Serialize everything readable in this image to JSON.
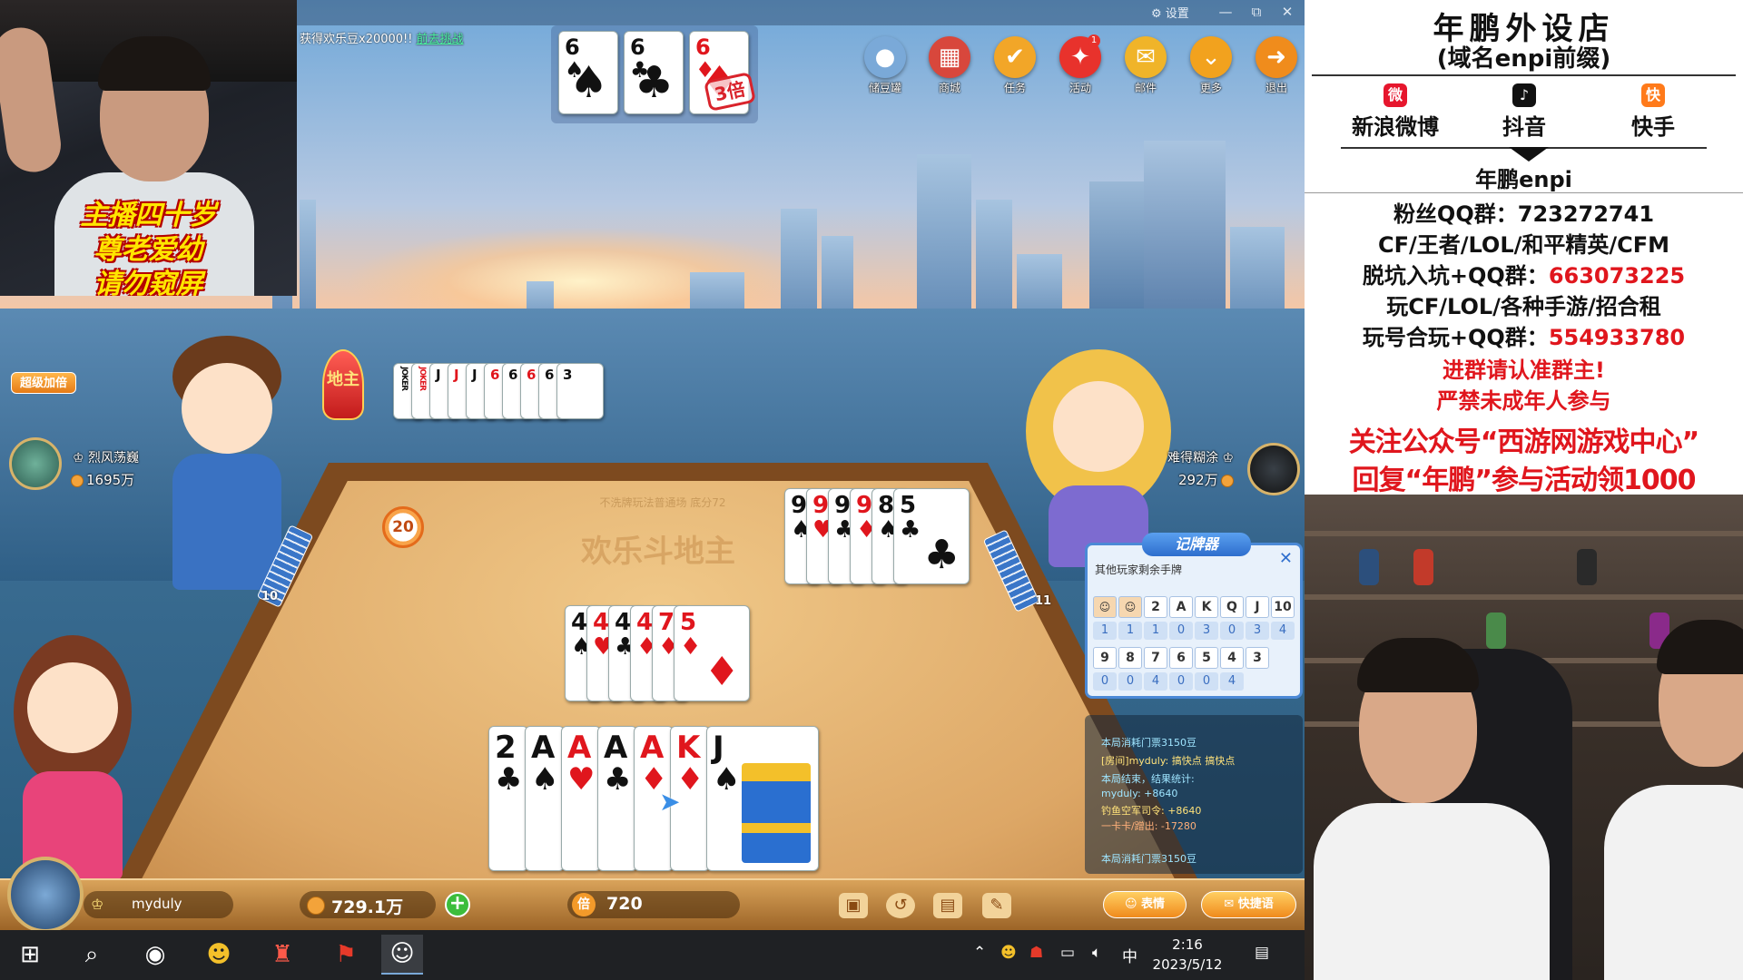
{
  "webcam_top": {
    "caption_lines": [
      "主播四十岁",
      "尊老爱幼",
      "请勿窥屏"
    ]
  },
  "game": {
    "titlebar": {
      "settings_label": "设置",
      "minimize": "—",
      "restore": "⧉",
      "close": "✕"
    },
    "reward_banner": {
      "text": "获得欢乐豆x20000!!",
      "link": "前去挑战"
    },
    "top_icons": [
      {
        "icon": "bean-bag-icon",
        "label": "储豆罐",
        "glyph": "●",
        "color": "#7aa9d8"
      },
      {
        "icon": "shop-icon",
        "label": "商城",
        "glyph": "▦",
        "color": "#d8473c"
      },
      {
        "icon": "task-icon",
        "label": "任务",
        "glyph": "✔",
        "color": "#f2a628"
      },
      {
        "icon": "gift-icon",
        "label": "活动",
        "glyph": "✦",
        "color": "#e8322c",
        "badge": "1"
      },
      {
        "icon": "mail-icon",
        "label": "邮件",
        "glyph": "✉",
        "color": "#f0b429"
      },
      {
        "icon": "more-icon",
        "label": "更多",
        "glyph": "⌄",
        "color": "#f2a21e"
      },
      {
        "icon": "exit-icon",
        "label": "退出",
        "glyph": "➜",
        "color": "#f08c1c"
      }
    ],
    "landlord_cards": [
      {
        "rank": "6",
        "suit": "♠",
        "color": "blk"
      },
      {
        "rank": "6",
        "suit": "♣",
        "color": "blk"
      },
      {
        "rank": "6",
        "suit": "♦",
        "color": "red"
      }
    ],
    "landlord_multiplier": "3倍",
    "table_info": "不洗牌玩法普通场 底分72",
    "table_logo": "欢乐斗地主",
    "super_double": "超级加倍",
    "landlord_badge": "地主",
    "timer": "20",
    "left_player": {
      "name": "烈风荡巍",
      "coins": "1695万",
      "cards_left": "10"
    },
    "right_player": {
      "name": "难得糊涂",
      "coins": "292万",
      "cards_left": "11"
    },
    "landlord_played_pile": [
      "JOKER",
      "JOKER",
      "J",
      "J",
      "J",
      "6",
      "6",
      "6",
      "6",
      "3"
    ],
    "right_played": [
      {
        "rank": "9",
        "suit": "♠",
        "color": "blk"
      },
      {
        "rank": "9",
        "suit": "♥",
        "color": "red"
      },
      {
        "rank": "9",
        "suit": "♣",
        "color": "blk"
      },
      {
        "rank": "9",
        "suit": "♦",
        "color": "red"
      },
      {
        "rank": "8",
        "suit": "♠",
        "color": "blk"
      },
      {
        "rank": "5",
        "suit": "♣",
        "color": "blk"
      }
    ],
    "center_played": [
      {
        "rank": "4",
        "suit": "♠",
        "color": "blk"
      },
      {
        "rank": "4",
        "suit": "♥",
        "color": "red"
      },
      {
        "rank": "4",
        "suit": "♣",
        "color": "blk"
      },
      {
        "rank": "4",
        "suit": "♦",
        "color": "red"
      },
      {
        "rank": "7",
        "suit": "♦",
        "color": "red"
      },
      {
        "rank": "5",
        "suit": "♦",
        "color": "red"
      }
    ],
    "my_hand": [
      {
        "rank": "2",
        "suit": "♣",
        "color": "blk"
      },
      {
        "rank": "A",
        "suit": "♠",
        "color": "blk"
      },
      {
        "rank": "A",
        "suit": "♥",
        "color": "red"
      },
      {
        "rank": "A",
        "suit": "♣",
        "color": "blk"
      },
      {
        "rank": "A",
        "suit": "♦",
        "color": "red"
      },
      {
        "rank": "K",
        "suit": "♦",
        "color": "red"
      },
      {
        "rank": "J",
        "suit": "♠",
        "color": "blk"
      }
    ],
    "tracker": {
      "title": "记牌器",
      "subtitle": "其他玩家剩余手牌",
      "row1_labels": [
        "大王",
        "小王",
        "2",
        "A",
        "K",
        "Q",
        "J",
        "10"
      ],
      "row1_counts": [
        "1",
        "1",
        "1",
        "0",
        "3",
        "0",
        "3",
        "4"
      ],
      "row2_labels": [
        "9",
        "8",
        "7",
        "6",
        "5",
        "4",
        "3"
      ],
      "row2_counts": [
        "0",
        "0",
        "4",
        "0",
        "0",
        "4"
      ]
    },
    "chat": [
      {
        "text": "本局消耗门票3150豆",
        "cls": ""
      },
      {
        "text": "[房间]myduly: 搞快点 搞快点",
        "cls": "y"
      },
      {
        "text": "本局结束，结果统计:",
        "cls": ""
      },
      {
        "text": "myduly: +8640",
        "cls": ""
      },
      {
        "text": "钓鱼空军司令: +8640",
        "cls": "y"
      },
      {
        "text": "一卡卡/蹭出: -17280",
        "cls": "o"
      },
      {
        "text": "本局消耗门票3150豆",
        "cls": ""
      }
    ],
    "me": {
      "name": "myduly",
      "coins": "729.1万",
      "multiplier_label": "倍",
      "multiplier": "720"
    },
    "bottom_buttons": {
      "emoji": "表情",
      "quick": "快捷语"
    }
  },
  "taskbar": {
    "time": "2:16",
    "date": "2023/5/12",
    "ime": "中"
  },
  "info_panel": {
    "title": "年鹏外设店",
    "subtitle": "(域名enpi前缀)",
    "socials": [
      {
        "label": "新浪微博",
        "icon": "weibo-icon",
        "glyph": "微",
        "color": "#e6162d"
      },
      {
        "label": "抖音",
        "icon": "douyin-icon",
        "glyph": "♪",
        "color": "#111111"
      },
      {
        "label": "快手",
        "icon": "kuaishou-icon",
        "glyph": "快",
        "color": "#ff7a1a"
      }
    ],
    "account": "年鹏enpi",
    "fan_group": "粉丝QQ群：723272741",
    "games_line": "CF/王者/LOL/和平精英/CFM",
    "group2_label": "脱坑入坑+QQ群：",
    "group2_num": "663073225",
    "rent_line": "玩CF/LOL/各种手游/招合租",
    "group3_label": "玩号合玩+QQ群：",
    "group3_num": "554933780",
    "warning1": "进群请认准群主!",
    "warning2": "严禁未成年人参与",
    "promo1": "关注公众号“西游网游戏中心”",
    "promo2": "回复“年鹏”参与活动领1000"
  }
}
